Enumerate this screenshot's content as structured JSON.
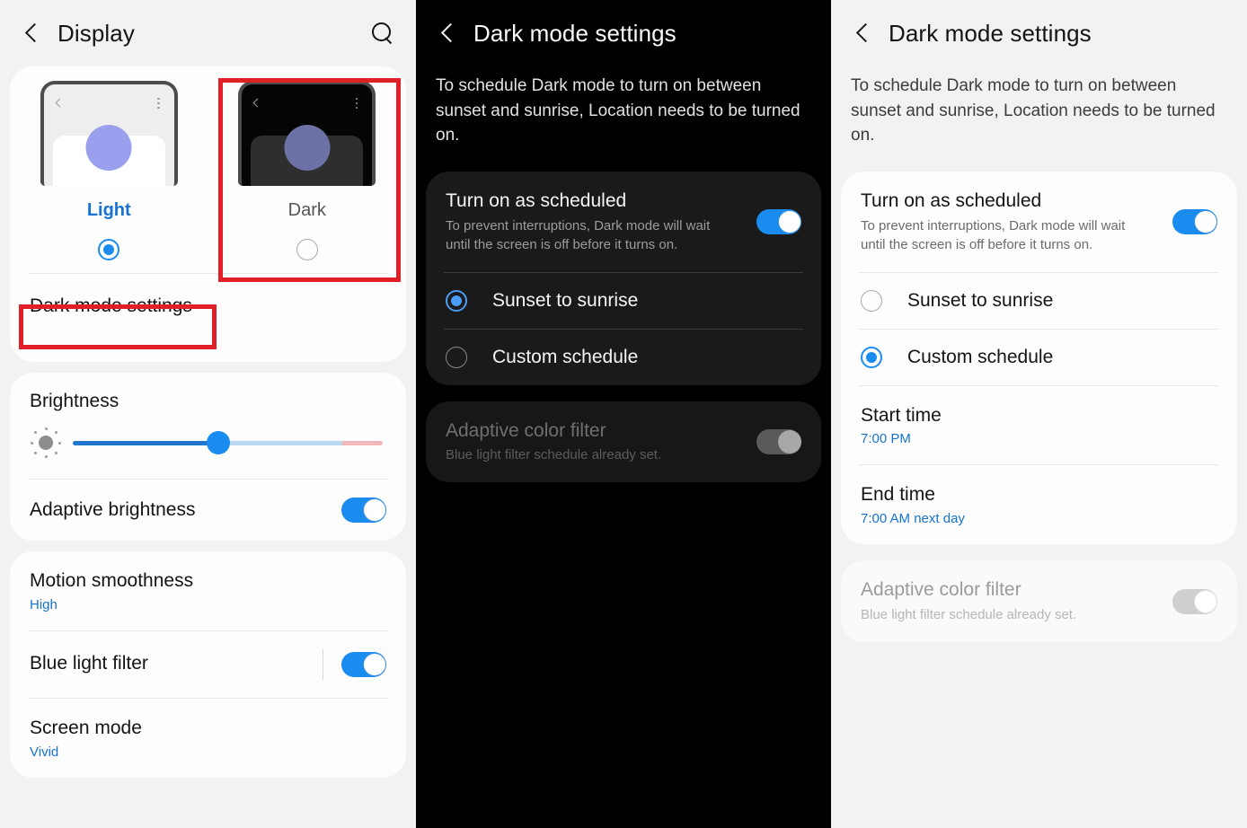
{
  "panel1": {
    "header": {
      "back_icon": "chevron-left-icon",
      "title": "Display",
      "search_icon": "search-icon"
    },
    "theme": {
      "options": [
        {
          "label": "Light",
          "selected": true
        },
        {
          "label": "Dark",
          "selected": false
        }
      ]
    },
    "dark_mode_settings_label": "Dark mode settings",
    "brightness": {
      "title": "Brightness",
      "icon": "brightness-sun-icon",
      "value_percent": 47,
      "warn_zone_percent": 13
    },
    "adaptive_brightness": {
      "label": "Adaptive brightness",
      "toggle": "on"
    },
    "motion_smoothness": {
      "label": "Motion smoothness",
      "value": "High"
    },
    "blue_light_filter": {
      "label": "Blue light filter",
      "toggle": "on"
    },
    "screen_mode": {
      "label": "Screen mode",
      "value": "Vivid"
    },
    "annotations": {
      "dark_tile_box": "red-highlight-box",
      "dark_mode_settings_box": "red-highlight-box"
    }
  },
  "panel2": {
    "header": {
      "back_icon": "chevron-left-icon",
      "title": "Dark mode settings"
    },
    "description": "To schedule Dark mode to turn on between sunset and sunrise, Location needs to be turned on.",
    "schedule": {
      "title": "Turn on as scheduled",
      "description": "To prevent interruptions, Dark mode will wait until the screen is off before it turns on.",
      "toggle": "on",
      "options": [
        {
          "label": "Sunset to sunrise",
          "selected": true
        },
        {
          "label": "Custom schedule",
          "selected": false
        }
      ]
    },
    "adaptive_color_filter": {
      "title": "Adaptive color filter",
      "description": "Blue light filter schedule already set.",
      "toggle": "off",
      "disabled": true
    }
  },
  "panel3": {
    "header": {
      "back_icon": "chevron-left-icon",
      "title": "Dark mode settings"
    },
    "description": "To schedule Dark mode to turn on between sunset and sunrise, Location needs to be turned on.",
    "schedule": {
      "title": "Turn on as scheduled",
      "description": "To prevent interruptions, Dark mode will wait until the screen is off before it turns on.",
      "toggle": "on",
      "options": [
        {
          "label": "Sunset to sunrise",
          "selected": false
        },
        {
          "label": "Custom schedule",
          "selected": true
        }
      ]
    },
    "start_time": {
      "label": "Start time",
      "value": "7:00 PM"
    },
    "end_time": {
      "label": "End time",
      "value": "7:00 AM next day"
    },
    "adaptive_color_filter": {
      "title": "Adaptive color filter",
      "description": "Blue light filter schedule already set.",
      "toggle": "off",
      "disabled": true
    }
  },
  "colors": {
    "accent_blue": "#1a8cf0",
    "link_blue": "#1673d1",
    "annotation_red": "#e01f26",
    "light_bg": "#f2f2f2",
    "dark_bg": "#000000",
    "dark_card": "#1a1a1a"
  }
}
